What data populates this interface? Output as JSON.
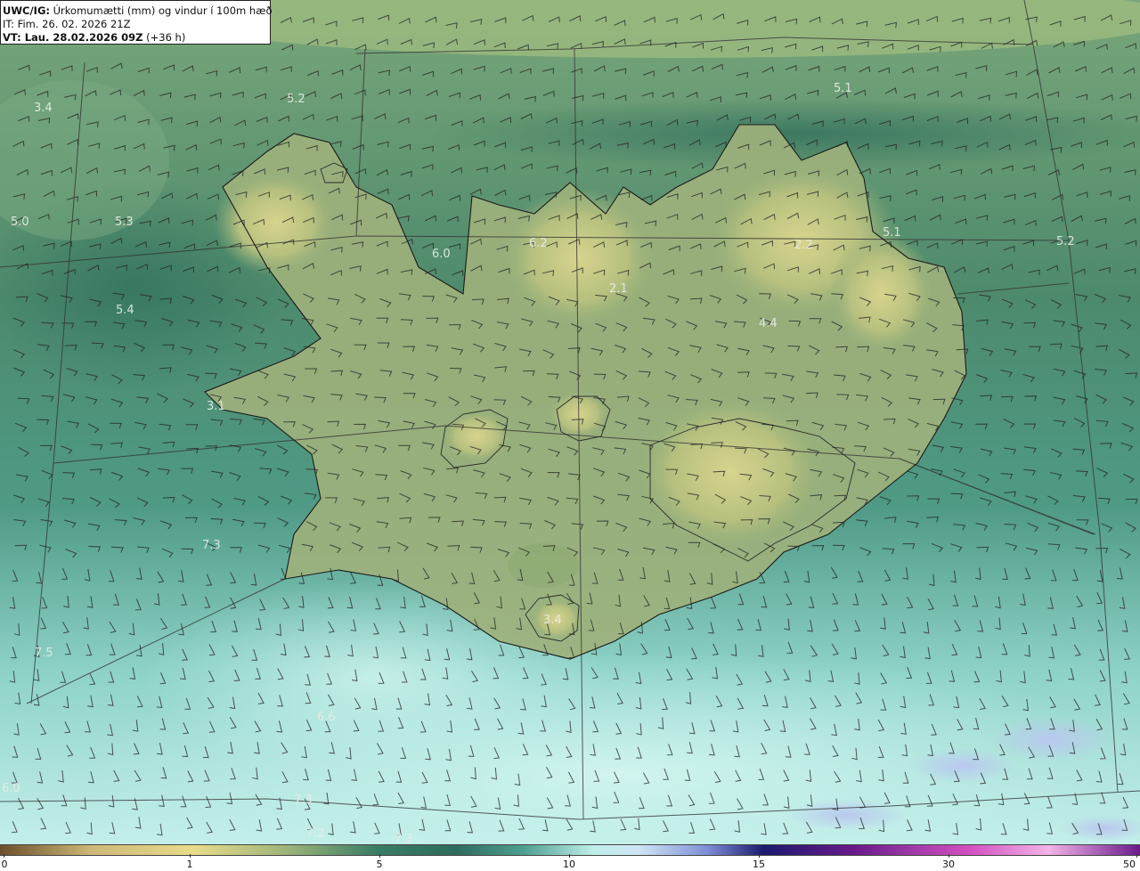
{
  "title_box": {
    "product_code": "UWC/IG:",
    "product_desc": " Úrkomumætti (mm) og vindur í 100m hæð",
    "init_time": "IT: Fim. 26. 02. 2026 21Z",
    "valid_prefix": "VT: Lau. 28.02.2026 09Z",
    "valid_suffix": " (+36 h)"
  },
  "map_labels": [
    {
      "text": "3.4"
    },
    {
      "text": "5.2"
    },
    {
      "text": "5.1"
    },
    {
      "text": "5.0"
    },
    {
      "text": "5.3"
    },
    {
      "text": "6.0"
    },
    {
      "text": "6.2"
    },
    {
      "text": "2.2"
    },
    {
      "text": "5.1"
    },
    {
      "text": "5.2"
    },
    {
      "text": "5.4"
    },
    {
      "text": "2.1"
    },
    {
      "text": "4.4"
    },
    {
      "text": "3.1"
    },
    {
      "text": "7.3"
    },
    {
      "text": "3.4"
    },
    {
      "text": "7.5"
    },
    {
      "text": "6.6"
    },
    {
      "text": "6.0"
    },
    {
      "text": "7.3"
    },
    {
      "text": "7.2"
    },
    {
      "text": "7.3"
    }
  ],
  "colorbar": {
    "ticks": [
      "0",
      "1",
      "5",
      "10",
      "15",
      "30",
      "50"
    ]
  },
  "colors": {
    "brown": "#6b4f2a",
    "tan": "#cdb878",
    "yellow": "#e8dc8a",
    "olive_green": "#9fb57a",
    "sea_green": "#3a7d66",
    "dark_teal": "#2e6b5e",
    "light_cyan": "#bfeee9",
    "pale_blue": "#cfe6f5",
    "navy": "#1a1a6e",
    "purple": "#6a1a8a",
    "magenta": "#d24fc0",
    "pink": "#f2b4e8"
  },
  "map_feature_names": {
    "coastline": "iceland-coastline",
    "graticule": "graticule-lines",
    "wind_barbs": "wind-barbs"
  }
}
